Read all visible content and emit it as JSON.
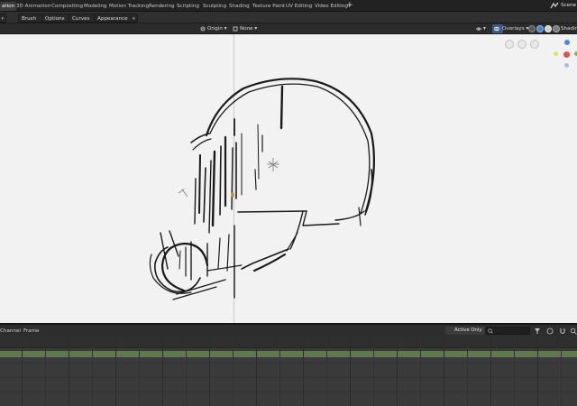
{
  "workspace_tabs": [
    {
      "label": "ation",
      "active": true
    },
    {
      "label": "3D Animation",
      "active": false
    },
    {
      "label": "Compositing",
      "active": false
    },
    {
      "label": "Modeling",
      "active": false
    },
    {
      "label": "Motion Tracking",
      "active": false
    },
    {
      "label": "Rendering",
      "active": false
    },
    {
      "label": "Scripting",
      "active": false
    },
    {
      "label": "Sculpting",
      "active": false
    },
    {
      "label": "Shading",
      "active": false
    },
    {
      "label": "Texture Paint",
      "active": false
    },
    {
      "label": "UV Editing",
      "active": false
    },
    {
      "label": "Video Editing",
      "active": false
    }
  ],
  "add_workspace": "+",
  "scene_label": "Scene",
  "tool_header": {
    "brush": "Brush",
    "options": "Options",
    "curves": "Curves",
    "appearance": "Appearance"
  },
  "viewport_header": {
    "origin": "Origin",
    "none": "None",
    "overlays": "Overlays",
    "shading": "Shading"
  },
  "timeline": {
    "channel": "Channel",
    "frame": "Frame",
    "active_only": "Active Only"
  },
  "colors": {
    "accent_blue": "#4a7fd0",
    "gizmo_red": "#e0524f",
    "gizmo_green": "#8ab833",
    "gizmo_blue": "#3f8ee0",
    "summary_green": "#5f7a4a",
    "stroke": "#1a1a1a"
  }
}
